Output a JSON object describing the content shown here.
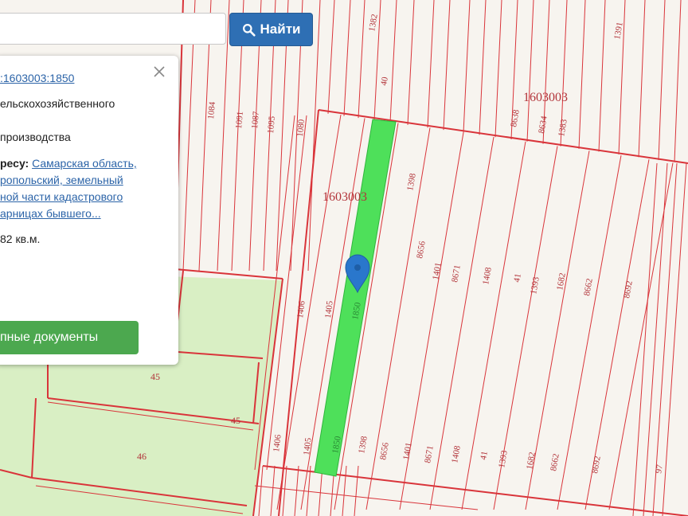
{
  "search": {
    "value": "",
    "button_label": "Найти"
  },
  "popup": {
    "cadastral_link": ":1603003:1850",
    "line1": "ельскохозяйственного",
    "line2": "производства",
    "address_label": "ресу:",
    "address_lines": [
      "Самарская область,",
      "ропольский, земельный",
      "ной части кадастрового",
      "арницах бывшего..."
    ],
    "area": "82 кв.м.",
    "docs_button": "упные документы"
  },
  "map": {
    "block_labels": [
      "1603003",
      "1603003"
    ],
    "parcel_numbers_top": [
      "1382",
      "40",
      "1391",
      "1084",
      "1091",
      "1087",
      "1095",
      "1080",
      "8638",
      "8634",
      "1383"
    ],
    "parcel_numbers_mid": [
      "1406",
      "1405",
      "1850",
      "1398",
      "8656",
      "1401",
      "8671",
      "1408",
      "41",
      "1393",
      "1682",
      "8662",
      "8692"
    ],
    "parcel_numbers_bottom": [
      "1406",
      "1405",
      "1850",
      "1398",
      "8656",
      "1401",
      "8671",
      "1408",
      "41",
      "1393",
      "1682",
      "8662",
      "8692",
      "97"
    ],
    "green_labels": [
      "45",
      "45",
      "46"
    ],
    "colors": {
      "boundary": "#d9343a",
      "selected_parcel": "#4ee05a",
      "agri_fill": "#d9efc4",
      "marker": "#2a77cc"
    },
    "icons": [
      "location-marker-icon"
    ]
  },
  "icons": {
    "search": "search-icon",
    "close": "close-icon"
  }
}
